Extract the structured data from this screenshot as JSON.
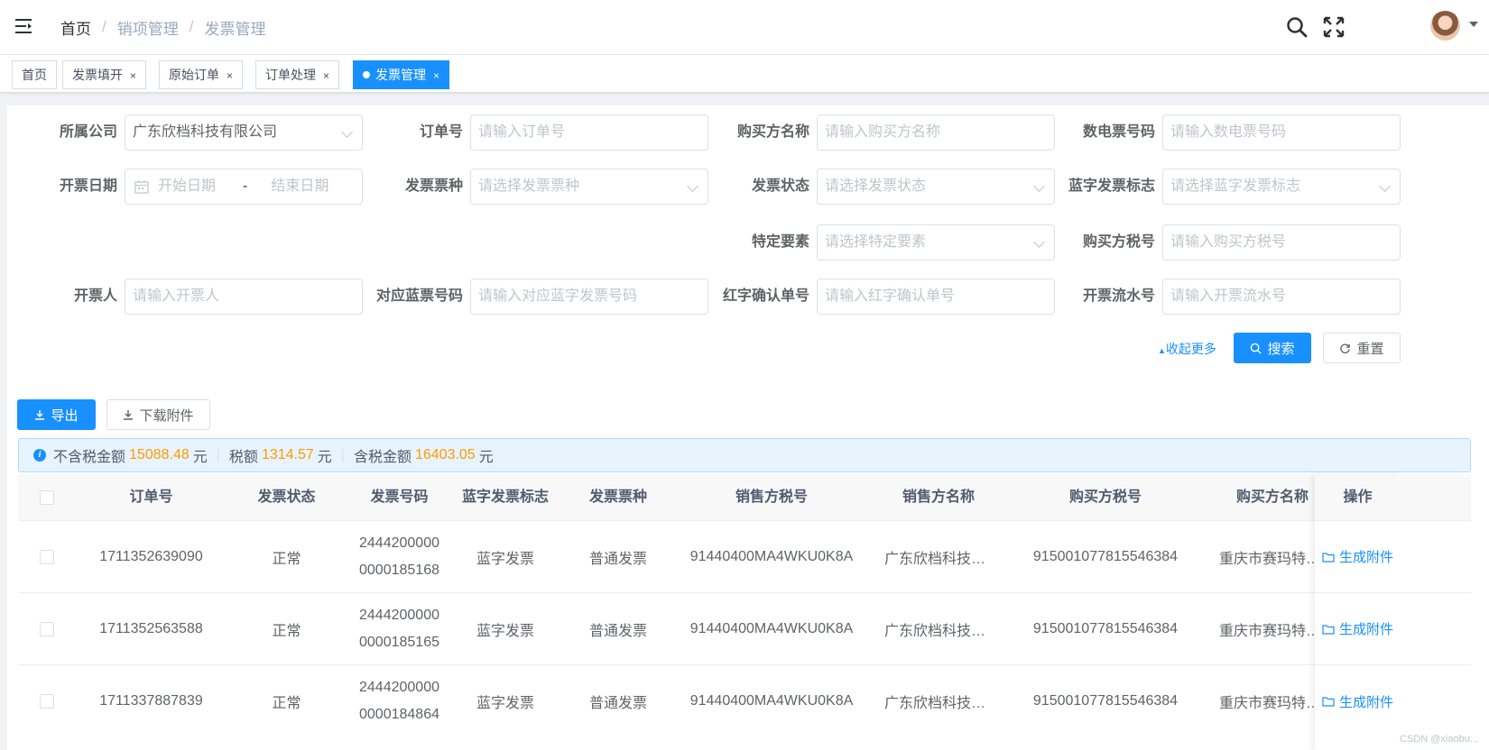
{
  "breadcrumb": {
    "home": "首页",
    "level1": "销项管理",
    "level2": "发票管理"
  },
  "icons": {
    "menu": "hamburger-icon",
    "search": "search-icon",
    "fullscreen": "fullscreen-icon",
    "avatar": "user-avatar",
    "dropdown": "caret-down-icon"
  },
  "tags": [
    {
      "label": "首页",
      "closable": false,
      "active": false
    },
    {
      "label": "发票填开",
      "closable": true,
      "active": false
    },
    {
      "label": "原始订单",
      "closable": true,
      "active": false
    },
    {
      "label": "订单处理",
      "closable": true,
      "active": false
    },
    {
      "label": "发票管理",
      "closable": true,
      "active": true
    }
  ],
  "tag_close": "×",
  "form": {
    "company": {
      "label": "所属公司",
      "value": "广东欣档科技有限公司"
    },
    "order_no": {
      "label": "订单号",
      "placeholder": "请输入订单号"
    },
    "buyer_name": {
      "label": "购买方名称",
      "placeholder": "请输入购买方名称"
    },
    "digital_no": {
      "label": "数电票号码",
      "placeholder": "请输入数电票号码"
    },
    "issue_date": {
      "label": "开票日期",
      "start": "开始日期",
      "sep": "-",
      "end": "结束日期"
    },
    "invoice_type": {
      "label": "发票票种",
      "placeholder": "请选择发票票种"
    },
    "invoice_status": {
      "label": "发票状态",
      "placeholder": "请选择发票状态"
    },
    "blue_flag": {
      "label": "蓝字发票标志",
      "placeholder": "请选择蓝字发票标志"
    },
    "special": {
      "label": "特定要素",
      "placeholder": "请选择特定要素"
    },
    "buyer_tax": {
      "label": "购买方税号",
      "placeholder": "请输入购买方税号"
    },
    "issuer": {
      "label": "开票人",
      "placeholder": "请输入开票人"
    },
    "blue_no": {
      "label": "对应蓝票号码",
      "placeholder": "请输入对应蓝字发票号码"
    },
    "red_confirm": {
      "label": "红字确认单号",
      "placeholder": "请输入红字确认单号"
    },
    "serial": {
      "label": "开票流水号",
      "placeholder": "请输入开票流水号"
    }
  },
  "actions": {
    "collapse": "收起更多",
    "search": "搜索",
    "reset": "重置",
    "export": "导出",
    "download": "下载附件"
  },
  "summary": {
    "excl_label": "不含税金额",
    "excl_value": "15088.48",
    "tax_label": "税额",
    "tax_value": "1314.57",
    "incl_label": "含税金额",
    "incl_value": "16403.05",
    "unit": "元"
  },
  "table": {
    "columns": [
      "订单号",
      "发票状态",
      "发票号码",
      "蓝字发票标志",
      "发票票种",
      "销售方税号",
      "销售方名称",
      "购买方税号",
      "购买方名称",
      "操作"
    ],
    "rows": [
      {
        "order_no": "1711352639090",
        "status": "正常",
        "inv_no_1": "2444200000",
        "inv_no_2": "0000185168",
        "blue_flag": "蓝字发票",
        "type": "普通发票",
        "seller_tax": "91440400MA4WKU0K8A",
        "seller_name": "广东欣档科技有限公司",
        "buyer_tax": "915001077815546384",
        "buyer_name": "重庆市赛玛特科技有限公司",
        "op": "生成附件"
      },
      {
        "order_no": "1711352563588",
        "status": "正常",
        "inv_no_1": "2444200000",
        "inv_no_2": "0000185165",
        "blue_flag": "蓝字发票",
        "type": "普通发票",
        "seller_tax": "91440400MA4WKU0K8A",
        "seller_name": "广东欣档科技有限公司",
        "buyer_tax": "915001077815546384",
        "buyer_name": "重庆市赛玛特科技有限公司",
        "op": "生成附件"
      },
      {
        "order_no": "1711337887839",
        "status": "正常",
        "inv_no_1": "2444200000",
        "inv_no_2": "0000184864",
        "blue_flag": "蓝字发票",
        "type": "普通发票",
        "seller_tax": "91440400MA4WKU0K8A",
        "seller_name": "广东欣档科技有限公司",
        "buyer_tax": "915001077815546384",
        "buyer_name": "重庆市赛玛特科技有限公司",
        "op": "生成附件"
      }
    ]
  },
  "watermark": "CSDN @xiaobu..."
}
